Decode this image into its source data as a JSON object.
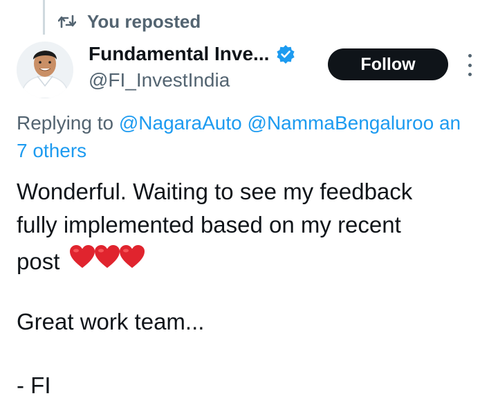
{
  "repost": {
    "label": "You reposted",
    "icon": "repost-icon"
  },
  "author": {
    "name": "Fundamental Inve...",
    "handle": "@FI_InvestIndia",
    "verified": true,
    "avatar": "avatar"
  },
  "actions": {
    "follow_label": "Follow",
    "more_icon": "more-options-icon"
  },
  "reply": {
    "prefix": "Replying to",
    "mentions": [
      "@NagaraAuto",
      "@NammaBengaluroo"
    ],
    "suffix": "an",
    "others": "7 others"
  },
  "post": {
    "lines": [
      "Wonderful. Waiting to see my feedback",
      "fully implemented based on my recent",
      "post"
    ],
    "emoji": "❤️❤️❤️",
    "line4": "Great work team...",
    "line5": "- FI"
  },
  "colors": {
    "accent": "#1d9bf0",
    "text": "#0f1419",
    "muted": "#536471",
    "heart": "#e0242e"
  }
}
